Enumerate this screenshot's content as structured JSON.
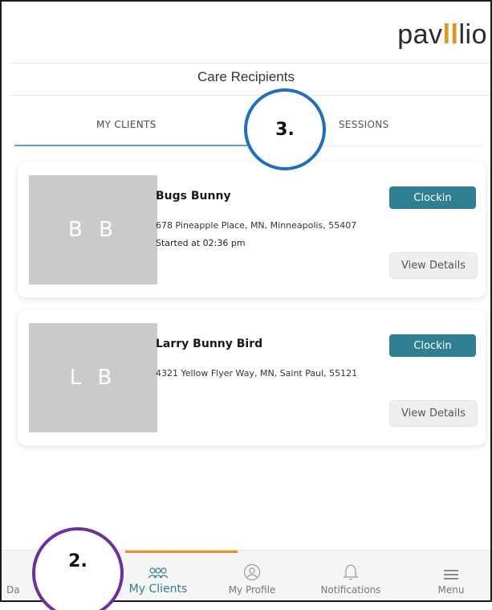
{
  "brand": {
    "logo_prefix": "pav",
    "logo_bars": "ll",
    "logo_suffix": "lio"
  },
  "page": {
    "title": "Care Recipients"
  },
  "tabs": [
    {
      "label": "MY CLIENTS",
      "active": true
    },
    {
      "label": "SESSIONS",
      "active": false
    }
  ],
  "annotations": {
    "three": "3.",
    "two": "2."
  },
  "clients": [
    {
      "initials": "B B",
      "name": "Bugs Bunny",
      "address": "678 Pineapple Place, MN, Minneapolis, 55407",
      "started": "Started at 02:36 pm",
      "clockin_label": "Clockin",
      "details_label": "View Details"
    },
    {
      "initials": "L B",
      "name": "Larry Bunny Bird",
      "address": "4321 Yellow Flyer Way, MN, Saint Paul, 55121",
      "started": "",
      "clockin_label": "Clockin",
      "details_label": "View Details"
    }
  ],
  "nav": {
    "dashboard": {
      "label": "Da",
      "icon": "dashboard-icon"
    },
    "my_clients": {
      "label": "My Clients",
      "icon": "people-icon",
      "active": true
    },
    "my_profile": {
      "label": "My Profile",
      "icon": "user-circle-icon"
    },
    "notifications": {
      "label": "Notifications",
      "icon": "bell-icon"
    },
    "menu": {
      "label": "Menu",
      "icon": "hamburger-icon"
    }
  },
  "colors": {
    "accent_teal": "#2f7f93",
    "brand_orange": "#e8941c",
    "annotation_blue": "#1f6fbf",
    "annotation_purple": "#6b2fa2"
  }
}
